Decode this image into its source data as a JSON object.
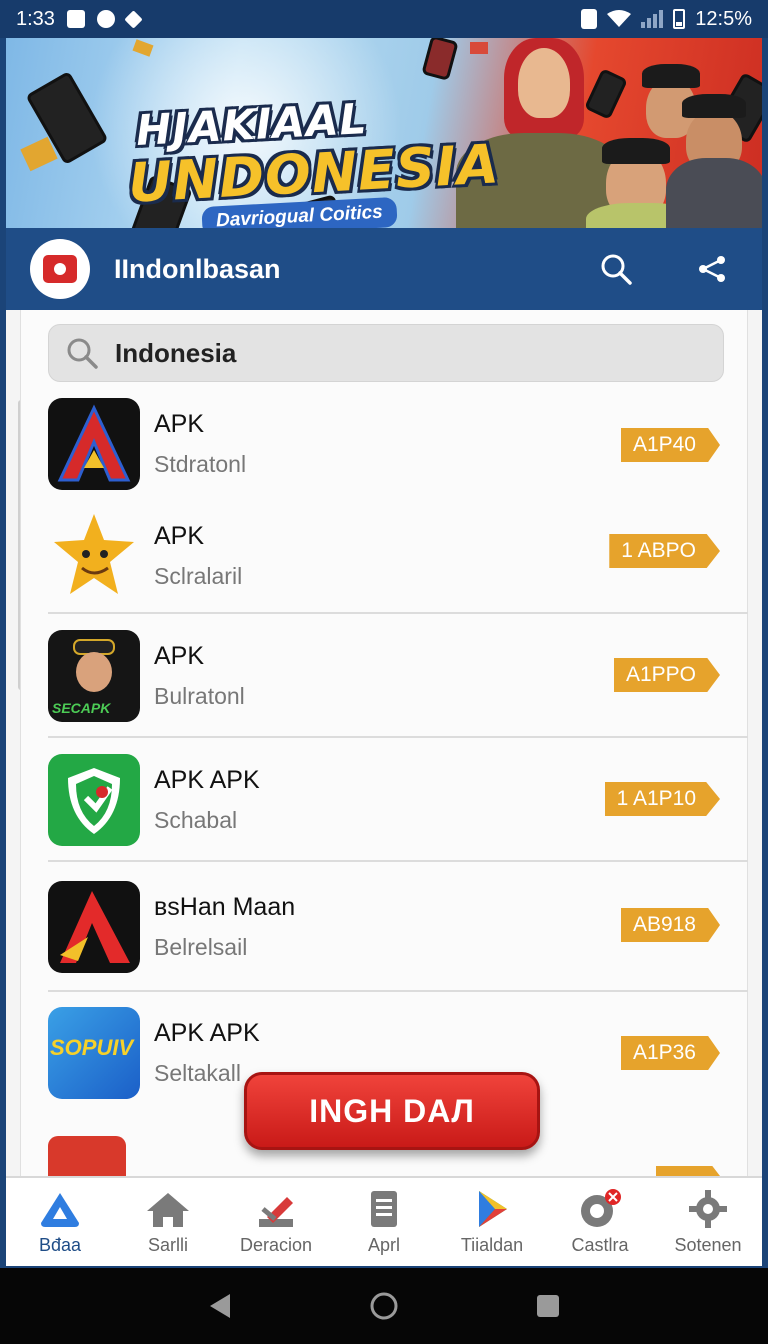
{
  "status_bar": {
    "time": "1:33",
    "battery": "12:5%",
    "icons": [
      "image-icon",
      "vpn-icon",
      "diamond-icon",
      "phone-vibrate-icon",
      "wifi-icon",
      "signal-icon",
      "battery-icon"
    ]
  },
  "banner": {
    "title_line1": "HJAKIAAL",
    "title_line2": "UNDONESIA",
    "tagline": "Davriogual Coitics",
    "colors": {
      "sky": "#9fcbe9",
      "accent_red": "#e5482e",
      "title_yellow": "#f6c12a"
    }
  },
  "app_bar": {
    "title": "IIndonlbasan",
    "icons": [
      "search-icon",
      "share-icon"
    ]
  },
  "search": {
    "value": "Indonesia",
    "icon": "search-icon"
  },
  "apps": [
    {
      "title": "APK",
      "subtitle": "Stdratonl",
      "tag": "A1P40"
    },
    {
      "title": "APK",
      "subtitle": "Sclralaril",
      "tag": "1 ABPO"
    },
    {
      "title": "APK",
      "subtitle": "Bulratonl",
      "tag": "A1PPO",
      "icon_text": "SECAPK"
    },
    {
      "title": "APK APK",
      "subtitle": "Schabal",
      "tag": "1 A1P10"
    },
    {
      "title": "вsHan Maan",
      "subtitle": "Belrelsail",
      "tag": "AB918"
    },
    {
      "title": "APK APK",
      "subtitle": "Seltakall",
      "tag": "A1P36",
      "icon_text": "SOPUIV"
    }
  ],
  "cta": {
    "label": "INGH DAЛ",
    "color": "#e0302b"
  },
  "bottom_nav": [
    {
      "label": "Bđaa",
      "icon": "home-triangle-icon",
      "active": true
    },
    {
      "label": "Sarlli",
      "icon": "house-icon",
      "active": false
    },
    {
      "label": "Deracion",
      "icon": "edit-icon",
      "active": false
    },
    {
      "label": "Aprl",
      "icon": "document-icon",
      "active": false
    },
    {
      "label": "Tiialdan",
      "icon": "play-store-icon",
      "active": false
    },
    {
      "label": "Castlra",
      "icon": "badge-notification-icon",
      "active": false
    },
    {
      "label": "Sotenen",
      "icon": "gear-icon",
      "active": false
    }
  ],
  "system_nav": [
    "back-icon",
    "home-icon",
    "recents-icon"
  ],
  "theme": {
    "primary": "#1f4d87",
    "tag_orange": "#e6a32c"
  }
}
